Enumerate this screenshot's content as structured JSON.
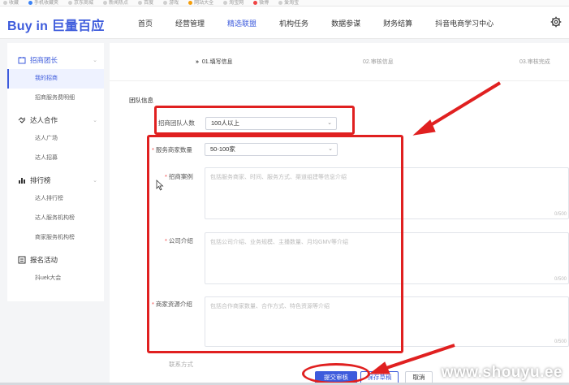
{
  "bookmarks": [
    {
      "label": "收藏"
    },
    {
      "label": "手机收藏夹"
    },
    {
      "label": "京东商城"
    },
    {
      "label": "新闻热点"
    },
    {
      "label": "百度"
    },
    {
      "label": "游戏"
    },
    {
      "label": "网站大全"
    },
    {
      "label": "淘宝网"
    },
    {
      "label": "微博"
    },
    {
      "label": "爱淘宝"
    }
  ],
  "header": {
    "logo": "Buy in 巨量百应",
    "nav": [
      {
        "label": "首页"
      },
      {
        "label": "经营管理"
      },
      {
        "label": "精选联盟"
      },
      {
        "label": "机构任务"
      },
      {
        "label": "数据参谋"
      },
      {
        "label": "财务结算"
      },
      {
        "label": "抖音电商学习中心"
      }
    ],
    "active_nav_index": 2,
    "accent": "#3d5bdc"
  },
  "sidebar": {
    "sections": [
      {
        "label": "招商团长",
        "icon": "team-icon",
        "items": [
          {
            "label": "我的招商"
          },
          {
            "label": "招商服务费明细"
          }
        ]
      },
      {
        "label": "达人合作",
        "icon": "handshake-icon",
        "items": [
          {
            "label": "达人广场"
          },
          {
            "label": "达人招募"
          }
        ]
      },
      {
        "label": "排行榜",
        "icon": "ranking-icon",
        "items": [
          {
            "label": "达人排行榜"
          },
          {
            "label": "达人服务机构榜"
          },
          {
            "label": "商家服务机构榜"
          }
        ]
      },
      {
        "label": "报名活动",
        "icon": "activity-icon",
        "items": [
          {
            "label": "抖uek大会"
          }
        ]
      }
    ]
  },
  "steps": [
    {
      "label": "01.填写信息",
      "marker": "»"
    },
    {
      "label": "02.审核信息"
    },
    {
      "label": "03.审核完成"
    }
  ],
  "form": {
    "section_title": "团队信息",
    "team_size": {
      "label": "招商团队人数",
      "value": "100人以上"
    },
    "merchant_count": {
      "label": "服务商家数量",
      "value": "50-100家"
    },
    "cases": {
      "label": "招商案例",
      "placeholder": "包括服务商家、时间、服务方式、渠道组建等信息介绍",
      "counter": "0/500"
    },
    "company_intro": {
      "label": "公司介绍",
      "placeholder": "包括公司介绍、业务规模、主播数量、月均GMV等介绍",
      "counter": "0/500"
    },
    "resource_intro": {
      "label": "商家资源介绍",
      "placeholder": "包括合作商家数量、合作方式、特色资源等介绍",
      "counter": "0/500"
    },
    "next_label": "联系方式"
  },
  "actions": {
    "submit": "提交审核",
    "save_draft": "保存草稿",
    "cancel": "取消"
  },
  "watermark": "www.shouyu.ee",
  "annotation_color": "#e02020"
}
